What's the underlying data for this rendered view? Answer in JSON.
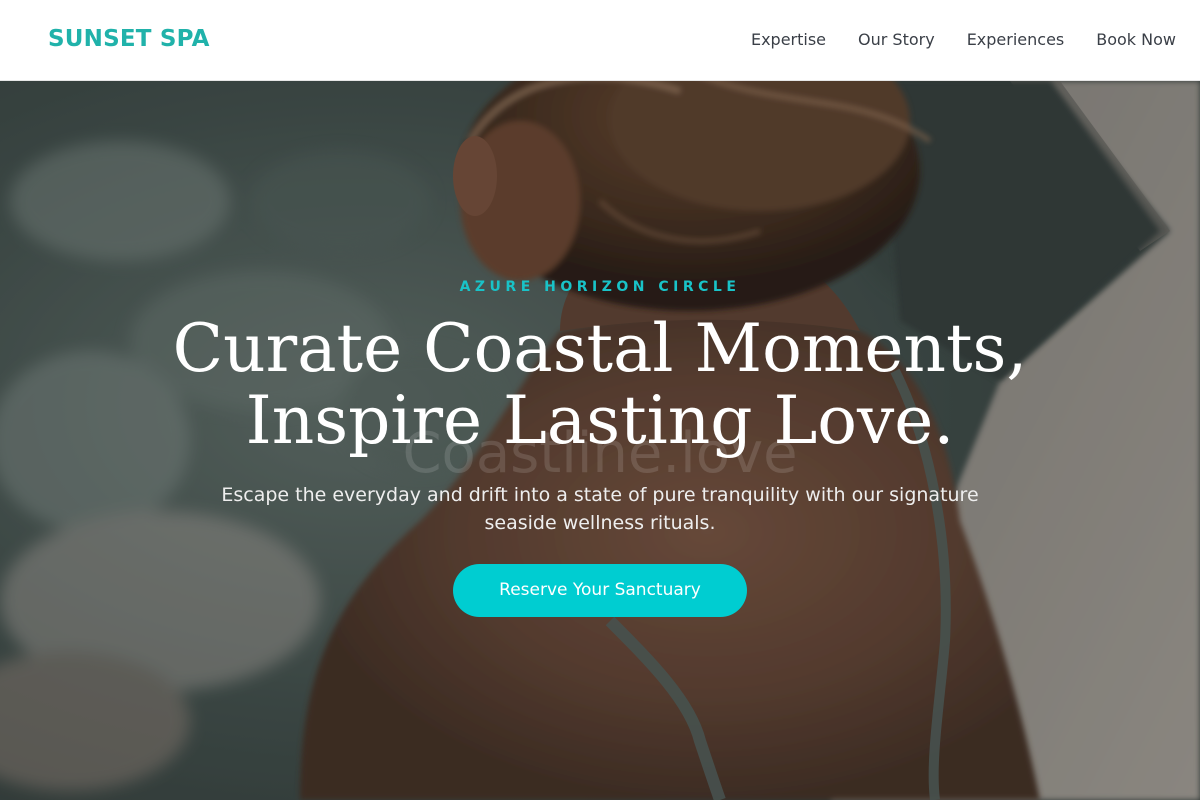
{
  "brand": {
    "name": "SUNSET SPA",
    "color": "#20b2aa"
  },
  "nav": {
    "links": [
      "Expertise",
      "Our Story",
      "Experiences",
      "Book Now"
    ]
  },
  "hero": {
    "eyebrow": "AZURE HORIZON CIRCLE",
    "headline_line1": "Curate Coastal Moments,",
    "headline_line2": "Inspire Lasting Love.",
    "watermark": "Coastline.love",
    "subtext": "Escape the everyday and drift into a state of pure tranquility with our signature seaside wellness rituals.",
    "cta_label": "Reserve Your Sanctuary",
    "accent_color": "#00cdd1",
    "background_image": "woman-in-spa-pool-photo"
  }
}
